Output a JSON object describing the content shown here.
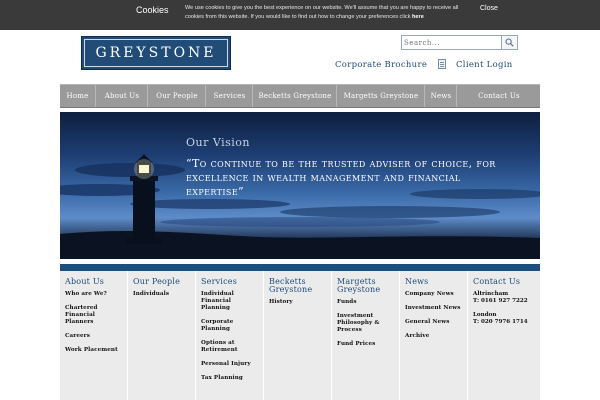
{
  "cookie_bar": {
    "title": "Cookies",
    "text": "We use cookies to give you the best experience on our website. We'll assume that you are happy to receive all cookies from this website. If you would like to find out how to change your preferences click",
    "link": "here",
    "close": "Close"
  },
  "header": {
    "logo": "GREYSTONE",
    "search_placeholder": "Search...",
    "corporate_brochure": "Corporate Brochure",
    "client_login": "Client Login"
  },
  "nav": [
    {
      "label": "Home"
    },
    {
      "label": "About Us"
    },
    {
      "label": "Our People"
    },
    {
      "label": "Services"
    },
    {
      "label": "Becketts Greystone"
    },
    {
      "label": "Margetts Greystone"
    },
    {
      "label": "News"
    },
    {
      "label": "Contact Us"
    }
  ],
  "hero": {
    "heading": "Our Vision",
    "quote": "“To continue to be the trusted adviser of choice, for excellence in wealth management and financial expertise”"
  },
  "footer": {
    "about": {
      "heading": "About Us",
      "links": [
        "Who are We?",
        "Chartered Financial Planners",
        "Careers",
        "Work Placement"
      ]
    },
    "people": {
      "heading": "Our People",
      "links": [
        "Individuals"
      ]
    },
    "services": {
      "heading": "Services",
      "links": [
        "Individual Financial Planning",
        "Corporate Planning",
        "Options at Retirement",
        "Personal Injury",
        "Tax Planning"
      ]
    },
    "becketts": {
      "heading": "Becketts Greystone",
      "links": [
        "History"
      ]
    },
    "margetts": {
      "heading": "Margetts Greystone",
      "links": [
        "Funds",
        "Investment Philosophy & Process",
        "Fund Prices"
      ]
    },
    "news": {
      "heading": "News",
      "links": [
        "Company News",
        "Investment News",
        "General News",
        "Archive"
      ]
    },
    "contact": {
      "heading": "Contact Us",
      "altrincham": "Altrincham",
      "altrincham_tel": "T: 0161 927 7222",
      "london": "London",
      "london_tel": "T: 020 7976 1714"
    }
  },
  "colors": {
    "brand_blue": "#214c78",
    "nav_grey": "#9a9a9a",
    "cookie_bar": "#3a3a3a",
    "footer_bg": "#ebebeb"
  }
}
